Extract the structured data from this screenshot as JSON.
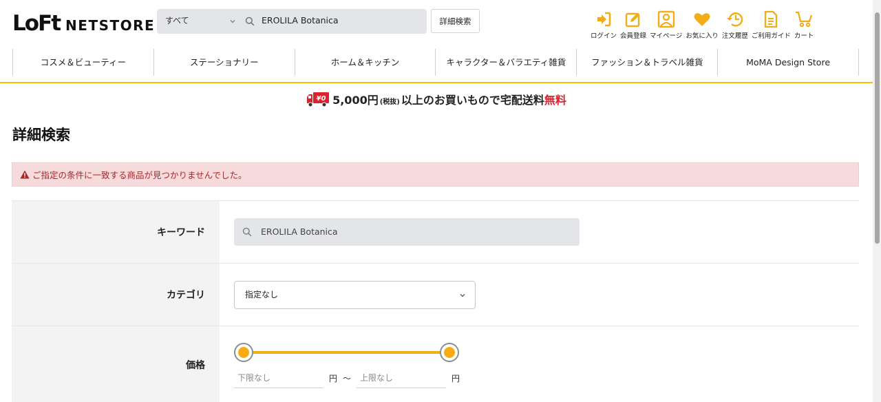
{
  "header": {
    "logo_mark": "LoFt",
    "logo_text": "NETSTORE",
    "search": {
      "category": "すべて",
      "value": "EROLILA Botanica"
    },
    "advanced_search_label": "詳細検索",
    "util_nav": [
      {
        "label": "ログイン",
        "icon": "login-icon"
      },
      {
        "label": "会員登録",
        "icon": "register-icon"
      },
      {
        "label": "マイページ",
        "icon": "mypage-icon"
      },
      {
        "label": "お気に入り",
        "icon": "heart-icon"
      },
      {
        "label": "注文履歴",
        "icon": "history-icon"
      },
      {
        "label": "ご利用ガイド",
        "icon": "guide-icon"
      },
      {
        "label": "カート",
        "icon": "cart-icon"
      }
    ],
    "accent_color": "#F2AD16"
  },
  "category_nav": [
    "コスメ＆ビューティー",
    "ステーショナリー",
    "ホーム＆キッチン",
    "キャラクター＆バラエティ雑貨",
    "ファッション＆トラベル雑貨",
    "MoMA Design Store"
  ],
  "shipping_banner": {
    "truck_label": "¥0",
    "amount": "5,000円",
    "tax": "(税抜)",
    "middle": "以上のお買いもので宅配送料",
    "free": "無料"
  },
  "main": {
    "page_title": "詳細検索",
    "alert_text": "ご指定の条件に一致する商品が見つかりませんでした。",
    "form": {
      "keyword_label": "キーワード",
      "keyword_value": "EROLILA Botanica",
      "category_label": "カテゴリ",
      "category_value": "指定なし",
      "price_label": "価格",
      "price_min_placeholder": "下限なし",
      "price_max_placeholder": "上限なし",
      "price_unit": "円",
      "price_separator": "～"
    }
  }
}
